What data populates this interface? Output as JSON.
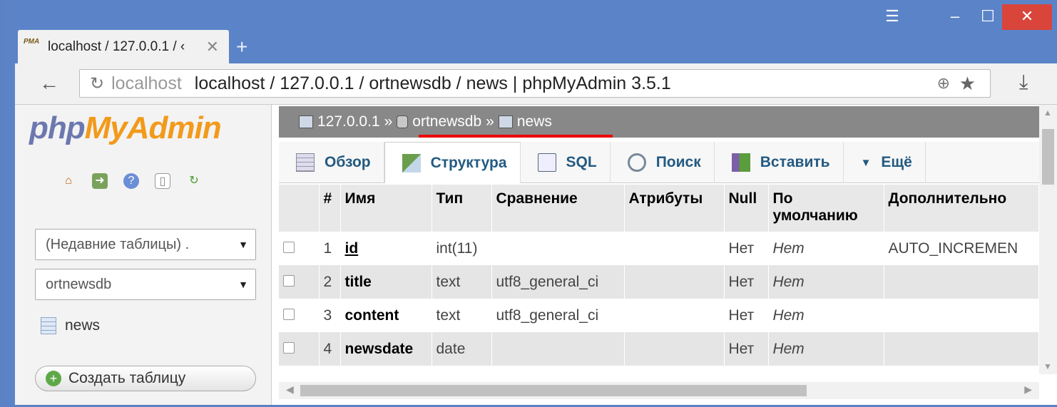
{
  "browser": {
    "tab_title": "localhost / 127.0.0.1 / ‹",
    "tab_close": "✕",
    "new_tab": "+",
    "url_host": "localhost",
    "url_title": "localhost / 127.0.0.1 / ortnewsdb / news | phpMyAdmin 3.5.1"
  },
  "sidebar": {
    "logo_php": "php",
    "logo_my": "My",
    "logo_admin": "Admin",
    "recent_tables": "(Недавние таблицы) .",
    "database": "ortnewsdb",
    "table_item": "news",
    "create_table": "Создать таблицу"
  },
  "breadcrumb": {
    "server": "127.0.0.1",
    "sep1": "»",
    "db": "ortnewsdb",
    "sep2": "»",
    "table": "news"
  },
  "tabs": [
    {
      "label": "Обзор"
    },
    {
      "label": "Структура"
    },
    {
      "label": "SQL"
    },
    {
      "label": "Поиск"
    },
    {
      "label": "Вставить"
    },
    {
      "label": "Ещё"
    }
  ],
  "table": {
    "headers": [
      "#",
      "Имя",
      "Тип",
      "Сравнение",
      "Атрибуты",
      "Null",
      "По умолчанию",
      "Дополнительно"
    ],
    "rows": [
      {
        "num": "1",
        "name": "id",
        "type": "int(11)",
        "collation": "",
        "attributes": "",
        "null": "Нет",
        "default": "Нет",
        "extra": "AUTO_INCREMEN"
      },
      {
        "num": "2",
        "name": "title",
        "type": "text",
        "collation": "utf8_general_ci",
        "attributes": "",
        "null": "Нет",
        "default": "Нет",
        "extra": ""
      },
      {
        "num": "3",
        "name": "content",
        "type": "text",
        "collation": "utf8_general_ci",
        "attributes": "",
        "null": "Нет",
        "default": "Нет",
        "extra": ""
      },
      {
        "num": "4",
        "name": "newsdate",
        "type": "date",
        "collation": "",
        "attributes": "",
        "null": "Нет",
        "default": "Нет",
        "extra": ""
      }
    ]
  },
  "colors": {
    "window_frame": "#5b84c8",
    "close_button": "#d9443b",
    "breadcrumb_bg": "#888888",
    "tab_text": "#235a81",
    "highlight_underline": "#ee0000"
  }
}
